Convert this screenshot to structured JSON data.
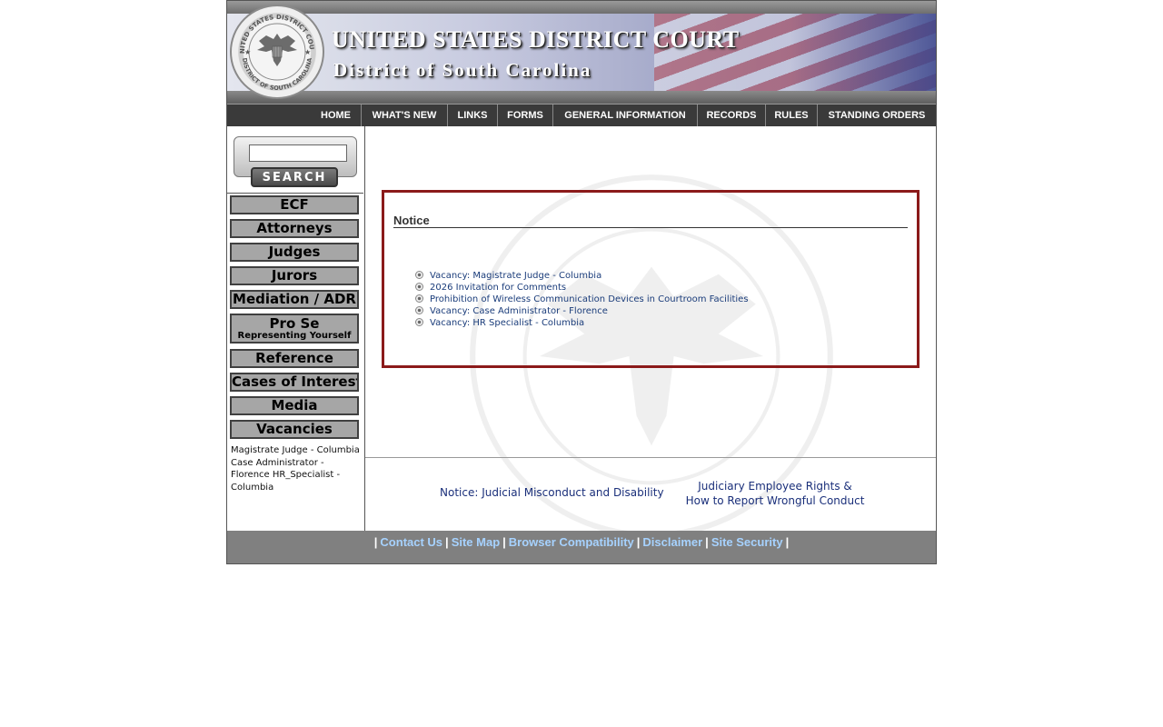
{
  "header": {
    "title": "UNITED STATES DISTRICT COURT",
    "subtitle": "District of South Carolina",
    "seal_text_top": "UNITED STATES DISTRICT COURT",
    "seal_text_bottom": "DISTRICT OF SOUTH CAROLINA"
  },
  "topnav": {
    "items": [
      {
        "label": "HOME"
      },
      {
        "label": "WHAT'S NEW"
      },
      {
        "label": "LINKS"
      },
      {
        "label": "FORMS"
      },
      {
        "label": "GENERAL INFORMATION"
      },
      {
        "label": "RECORDS"
      },
      {
        "label": "RULES"
      },
      {
        "label": "STANDING ORDERS"
      }
    ]
  },
  "search": {
    "value": "",
    "button_label": "SEARCH"
  },
  "sidebar": {
    "buttons": [
      {
        "label": "ECF"
      },
      {
        "label": "Attorneys"
      },
      {
        "label": "Judges"
      },
      {
        "label": "Jurors"
      },
      {
        "label": "Mediation / ADR"
      },
      {
        "label": "Pro Se",
        "sublabel": "Representing Yourself"
      },
      {
        "label": "Reference"
      },
      {
        "label": "Cases of Interest"
      },
      {
        "label": "Media"
      },
      {
        "label": "Vacancies"
      }
    ],
    "vacancies_ticker": "Magistrate Judge - Columbia Case Administrator - Florence HR_Specialist - Columbia"
  },
  "notice": {
    "title": "Notice",
    "items": [
      "Vacancy: Magistrate Judge - Columbia",
      "2026 Invitation for Comments",
      "Prohibition of Wireless Communication Devices in Courtroom Facilities",
      "Vacancy: Case Administrator - Florence",
      "Vacancy: HR Specialist - Columbia"
    ]
  },
  "links": {
    "judicial_misconduct": "Notice: Judicial Misconduct and Disability",
    "employee_rights_line1": "Judiciary Employee Rights &",
    "employee_rights_line2": "How to Report Wrongful Conduct"
  },
  "footer": {
    "links": [
      "Contact Us",
      "Site Map",
      "Browser Compatibility",
      "Disclaimer",
      "Site Security"
    ]
  },
  "colors": {
    "notice_border": "#8b1a1a",
    "link": "#1a3c7a",
    "footer_bg": "#808080",
    "footer_link": "#a6d2ff",
    "nav_bg": "#3a3a3a"
  }
}
